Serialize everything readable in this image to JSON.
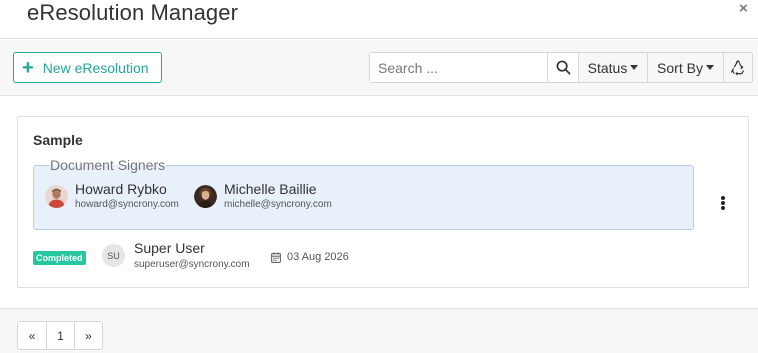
{
  "header": {
    "title": "eResolution Manager",
    "close_label": "×"
  },
  "toolbar": {
    "new_label": "New eResolution",
    "search_placeholder": "Search ...",
    "status_label": "Status",
    "sort_label": "Sort By"
  },
  "card": {
    "title": "Sample",
    "signers_legend": "Document Signers",
    "signers": [
      {
        "name": "Howard Rybko",
        "email": "howard@syncrony.com"
      },
      {
        "name": "Michelle Baillie",
        "email": "michelle@syncrony.com"
      }
    ],
    "status_badge": "Completed",
    "owner": {
      "initials": "SU",
      "name": "Super User",
      "email": "superuser@syncrony.com"
    },
    "date": "03 Aug 2026"
  },
  "pagination": {
    "prev": "«",
    "page": "1",
    "next": "»"
  },
  "colors": {
    "accent": "#26a69a",
    "badge": "#26c6a0",
    "signers_bg": "#e8f0fa"
  }
}
